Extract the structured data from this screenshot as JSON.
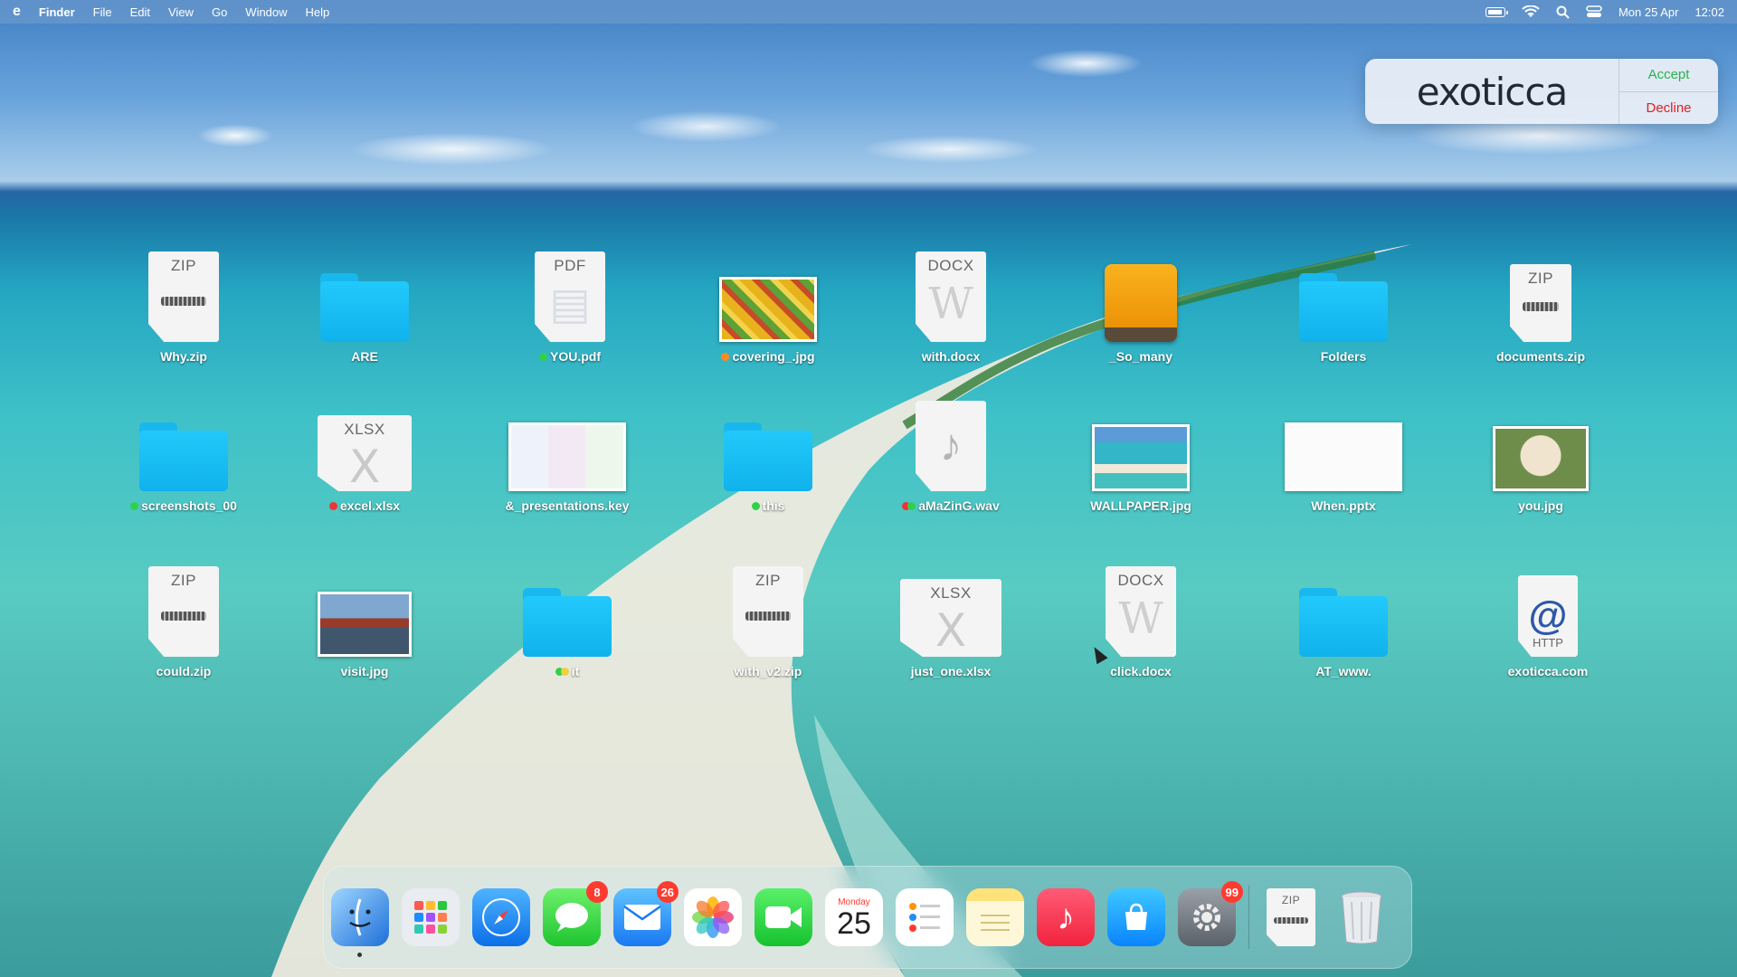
{
  "menubar": {
    "apple": "e",
    "app_name": "Finder",
    "menus": [
      "File",
      "Edit",
      "View",
      "Go",
      "Window",
      "Help"
    ],
    "date": "Mon 25 Apr",
    "time": "12:02"
  },
  "notification": {
    "brand": "exoticca",
    "accept": "Accept",
    "decline": "Decline"
  },
  "desktop": {
    "row1": [
      "Why.zip",
      "ARE",
      "YOU.pdf",
      "covering_.jpg",
      "with.docx",
      "_So_many",
      "Folders",
      "documents.zip"
    ],
    "row2": [
      "screenshots_00",
      "excel.xlsx",
      "&_presentations.key",
      "this",
      "aMaZinG.wav",
      "WALLPAPER.jpg",
      "When.pptx",
      "you.jpg"
    ],
    "row3": [
      "could.zip",
      "visit.jpg",
      "it",
      "with_v2.zip",
      "just_one.xlsx",
      "click.docx",
      "AT_www.",
      "exoticca.com"
    ]
  },
  "filetypes": {
    "zip": "ZIP",
    "pdf": "PDF",
    "docx": "DOCX",
    "xlsx": "XLSX",
    "http": "HTTP"
  },
  "dock": {
    "calendar_month": "Monday",
    "calendar_day": "25",
    "badges": {
      "messages": "8",
      "mail": "26",
      "settings": "99"
    },
    "zip_label": "ZIP"
  }
}
